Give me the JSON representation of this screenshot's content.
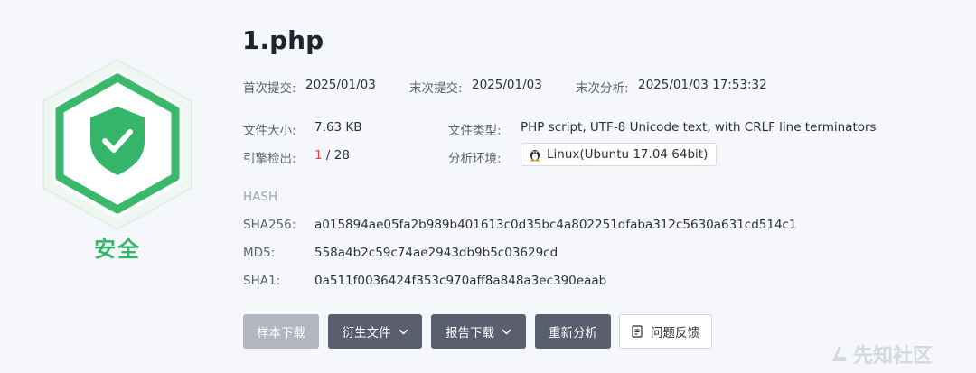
{
  "file": {
    "name": "1.php",
    "verdict": "安全"
  },
  "dates": {
    "first_label": "首次提交:",
    "first_value": "2025/01/03",
    "last_label": "末次提交:",
    "last_value": "2025/01/03",
    "analysis_label": "末次分析:",
    "analysis_value": "2025/01/03 17:53:32"
  },
  "info": {
    "size_label": "文件大小:",
    "size_value": "7.63 KB",
    "type_label": "文件类型:",
    "type_value": "PHP script, UTF-8 Unicode text, with CRLF line terminators",
    "engine_label": "引擎检出:",
    "engine_hits": "1",
    "engine_sep": " / ",
    "engine_total": "28",
    "env_label": "分析环境:",
    "env_value": "Linux(Ubuntu 17.04 64bit)",
    "env_icon": "linux-penguin-icon"
  },
  "hash": {
    "title": "HASH",
    "sha256_label": "SHA256:",
    "sha256_value": "a015894ae05fa2b989b401613c0d35bc4a802251dfaba312c5630a631cd514c1",
    "md5_label": "MD5:",
    "md5_value": "558a4b2c59c74ae2943db9b5c03629cd",
    "sha1_label": "SHA1:",
    "sha1_value": "0a511f0036424f353c970aff8a848a3ec390eaab"
  },
  "actions": {
    "sample_download": "样本下载",
    "derived_files": "衍生文件",
    "report_download": "报告下载",
    "reanalyze": "重新分析",
    "feedback": "问题反馈"
  },
  "watermark": "先知社区",
  "colors": {
    "safe_green": "#35b56a",
    "alert_red": "#e04343",
    "button_dark": "#5a5f70",
    "button_disabled": "#b3b6c0"
  }
}
